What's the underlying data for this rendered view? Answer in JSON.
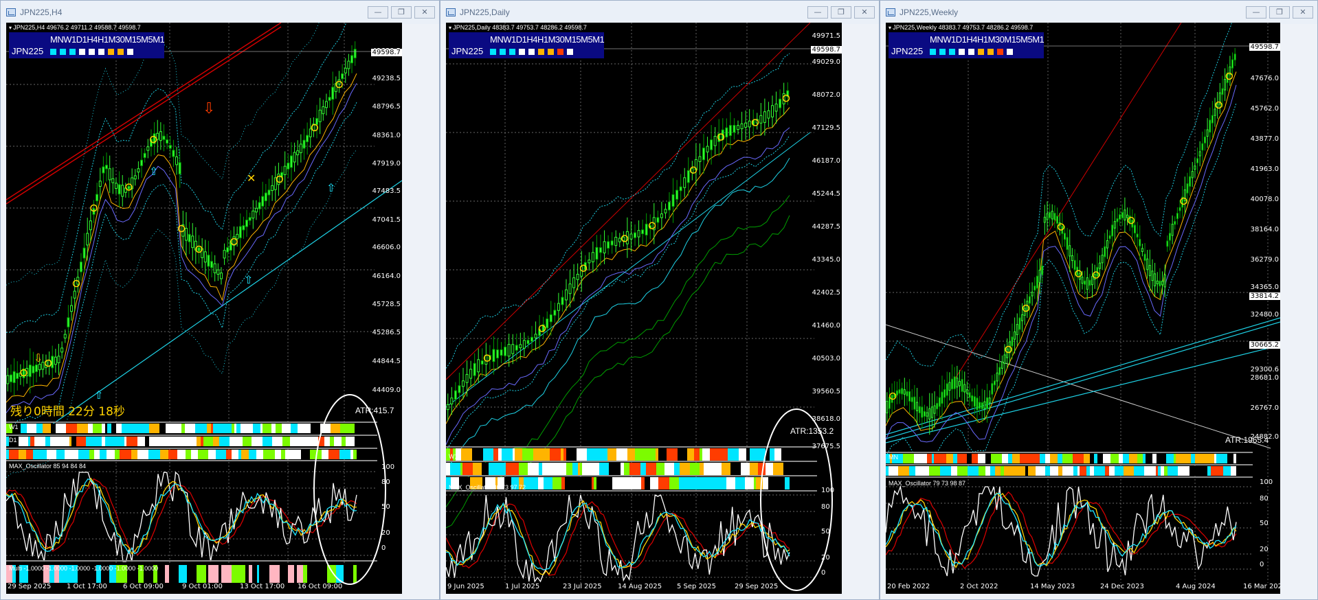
{
  "windows": [
    {
      "id": "h4",
      "title": "JPN225,H4",
      "ohlc": "JPN225,H4  49676.2 49711.2 49588.7 49598.7",
      "symbol": "JPN225",
      "timeframes": "MNW1D1H4H1M30M15M5M1",
      "price_labels": [
        "49680.5",
        "49238.5",
        "48796.5",
        "48361.0",
        "47919.0",
        "47483.5",
        "47041.5",
        "46606.0",
        "46164.0",
        "45728.5",
        "45286.5",
        "44844.5",
        "44409.0"
      ],
      "current_price": "49598.7",
      "date_labels": [
        "29 Sep 2025",
        "1 Oct 17:00",
        "6 Oct 09:00",
        "9 Oct 01:00",
        "13 Oct 17:00",
        "16 Oct 09:00"
      ],
      "atr": "ATR:415.7",
      "remaining_time": "残り0時間 22分 18秒",
      "strip_labels": [
        "W1",
        "D1",
        ""
      ],
      "oscillator_label": "MAX_Oscillator 85 94 84 84",
      "oscillator_scale": [
        "100",
        "80",
        "50",
        "20",
        "0"
      ],
      "multi_label": "Multi -1.0000 -1.0000 -1.0000 -1.0000 -1.0000 -1.0000",
      "multi_scale": [
        "1",
        "0",
        "-1"
      ]
    },
    {
      "id": "daily",
      "title": "JPN225,Daily",
      "ohlc": "JPN225,Daily  48383.7 49753.7 48286.2 49598.7",
      "symbol": "JPN225",
      "timeframes": "MNW1D1H4H1M30M15M5M1",
      "price_labels": [
        "49971.5",
        "49029.0",
        "48072.0",
        "47129.5",
        "46187.0",
        "45244.5",
        "44287.5",
        "43345.0",
        "42402.5",
        "41460.0",
        "40503.0",
        "39560.5",
        "38618.0",
        "37675.5"
      ],
      "current_price": "49598.7",
      "date_labels": [
        "9 Jun 2025",
        "1 Jul 2025",
        "23 Jul 2025",
        "14 Aug 2025",
        "5 Sep 2025",
        "29 Sep 2025"
      ],
      "atr": "ATR:1353.2",
      "strip_labels": [
        "",
        "W1",
        ""
      ],
      "oscillator_label": "MAX_Oscillator 80 73 97 72",
      "oscillator_scale": [
        "100",
        "80",
        "50",
        "20",
        "0"
      ]
    },
    {
      "id": "weekly",
      "title": "JPN225,Weekly",
      "ohlc": "JPN225,Weekly  48383.7 49753.7 48286.2 49598.7",
      "symbol": "JPN225",
      "timeframes": "MNW1D1H4H1M30M15M5M1",
      "price_labels": [
        "47676.0",
        "45762.0",
        "43877.0",
        "41963.0",
        "40078.0",
        "38164.0",
        "36279.0",
        "34365.0",
        "32480.0",
        "29300.6",
        "28681.0",
        "26767.0",
        "24882.0"
      ],
      "current_price": "49598.7",
      "hline_labels": [
        "33814.2",
        "30665.2"
      ],
      "date_labels": [
        "20 Feb 2022",
        "2 Oct 2022",
        "14 May 2023",
        "24 Dec 2023",
        "4 Aug 2024",
        "16 Mar 2025"
      ],
      "atr": "ATR:1965.4",
      "strip_labels": [
        "MN",
        ""
      ],
      "oscillator_label": "MAX_Oscillator 79 73 98 87",
      "oscillator_scale": [
        "100",
        "80",
        "50",
        "20",
        "0"
      ]
    }
  ],
  "badge_colors": [
    "#00e5ff",
    "#00e5ff",
    "#00e5ff",
    "#ffffff",
    "#ffffff",
    "#ffffff",
    "#ffb400",
    "#ffb400",
    "#ffffff"
  ],
  "badge_colors_daily": [
    "#00e5ff",
    "#00e5ff",
    "#00e5ff",
    "#ffffff",
    "#ffffff",
    "#ffb400",
    "#ffb400",
    "#ff3c00",
    "#ffffff"
  ],
  "window_controls": {
    "minimize": "—",
    "restore": "❐",
    "close": "✕"
  },
  "colors": {
    "up": "#32ff32",
    "down": "#00a000",
    "accent_cyan": "#1ed2e6",
    "red_line": "#d20000",
    "osc_yellow": "#ffd200",
    "osc_cyan": "#1ee6ff"
  }
}
